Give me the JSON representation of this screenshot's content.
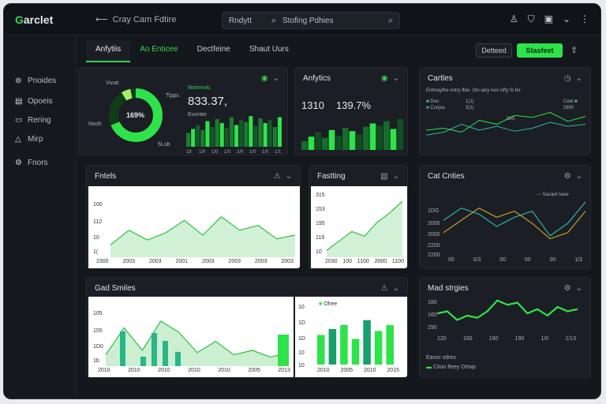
{
  "app": {
    "logo_g": "G",
    "logo_rest": "arclet",
    "back_label": "Cray Cam Fdtire"
  },
  "search": {
    "label": "Rndytt",
    "placeholder": "Stofing Pdhies"
  },
  "topbar_icons": [
    "user-icon",
    "filter-icon",
    "calendar-icon",
    "chevron-down-icon",
    "more-icon"
  ],
  "sidebar": {
    "items": [
      {
        "icon": "⊚",
        "label": "Pnoides"
      },
      {
        "icon": "▤",
        "label": "Opoeis"
      },
      {
        "icon": "▭",
        "label": "Rering"
      },
      {
        "icon": "△",
        "label": "Mirp"
      },
      {
        "icon": "⚙",
        "label": "Fnors"
      }
    ]
  },
  "tabs": [
    "Anfytiis",
    "Ao Enticee",
    "Dectfeine",
    "Shaut Uurs"
  ],
  "toolbar": {
    "outline_label": "Detteed",
    "green_label": "Stasfeet",
    "share_icon": "share-icon"
  },
  "cards": {
    "donut": {
      "center": "169%",
      "labels": [
        "Vurat",
        "Tipps",
        "Nooh",
        "5Lub"
      ],
      "metric": "833.37,",
      "legend_top": "Noinmvic",
      "legend_bottom": "Euvnter",
      "x_ticks": [
        "18",
        "1/0",
        "1/0",
        "1/0",
        "2/0",
        "1/0",
        "1/0",
        "1/1"
      ]
    },
    "analytics": {
      "title": "Anfytics",
      "v1": "1310",
      "v2": "139.7%"
    },
    "cartles": {
      "title": "Cartles",
      "caption": "Entmaythe entry fbie. Oin ainy neo cifty fo fer",
      "legend_a": "Doo",
      "legend_b": "Conjse",
      "legend_c": "Ceel",
      "legend_d": "2800",
      "value_label": "39S",
      "left_ticks": [
        "1(1)",
        "3(1)"
      ]
    },
    "fantels": {
      "title": "Fntels",
      "y_ticks": [
        "100",
        "112",
        "10",
        "1("
      ],
      "x_ticks": [
        "2300",
        "2003",
        "2003",
        "2001",
        "2003",
        "2003",
        "2003",
        "2003"
      ]
    },
    "fastting": {
      "title": "Fastting",
      "y_ticks": [
        "315",
        "153",
        "195",
        "119",
        "10"
      ],
      "x_ticks": [
        "2030",
        "100",
        "1100",
        "2000",
        "1100"
      ]
    },
    "cat_charts": {
      "title": "Cat Cnties",
      "legend": "Sacaet tawe",
      "y_ticks": [
        "1DG",
        "2000",
        "2000",
        "2200",
        "2200"
      ],
      "x_ticks": [
        "00",
        "0/3",
        "00",
        "00",
        "00",
        "1/3"
      ]
    },
    "cad_smiles": {
      "title": "Gad Smiles",
      "y_ticks": [
        "105",
        "155",
        "1D0",
        "1b"
      ],
      "x_ticks": [
        "2010",
        "2010",
        "2010",
        "2010",
        "2010",
        "2005",
        "2013"
      ],
      "y2_ticks": [
        "10",
        "1D",
        "1D",
        "10",
        "10"
      ],
      "legend": "Ohee",
      "x2_ticks": [
        "2010",
        "2005",
        "2010",
        "2015"
      ]
    },
    "mad_strings": {
      "title": "Mad strgies",
      "y_ticks": [
        "180",
        "160",
        "290"
      ],
      "x_ticks": [
        "120",
        "100",
        "190",
        "190",
        "1/0",
        "1/13"
      ],
      "footer_label": "Eaner sdres",
      "footer_legend": "Citoo fteey Ortwp"
    }
  },
  "chart_data": [
    {
      "type": "pie",
      "values": [
        69,
        31
      ],
      "title": ""
    },
    {
      "type": "bar",
      "values": [
        14,
        18,
        22,
        17,
        26,
        20,
        28,
        24,
        19,
        30,
        22,
        27,
        25,
        31,
        21,
        29,
        24,
        27,
        20,
        30
      ]
    },
    {
      "type": "bar",
      "values": [
        8,
        12,
        16,
        11,
        18,
        13,
        20,
        17,
        14,
        21,
        24,
        22,
        26,
        19,
        28
      ]
    },
    {
      "type": "line",
      "series": [
        {
          "values": [
            20,
            22,
            18,
            30,
            26,
            35,
            33,
            38,
            29,
            34
          ]
        },
        {
          "values": [
            15,
            18,
            26,
            20,
            24,
            19,
            22,
            28,
            24,
            26
          ]
        }
      ]
    },
    {
      "type": "area",
      "values": [
        10,
        22,
        14,
        20,
        30,
        18,
        33,
        22,
        26,
        15,
        18
      ]
    },
    {
      "type": "area",
      "values": [
        6,
        14,
        22,
        18,
        30,
        38,
        48
      ]
    },
    {
      "type": "line",
      "series": [
        {
          "values": [
            22,
            30,
            26,
            18,
            24,
            28,
            12,
            20,
            34
          ]
        },
        {
          "values": [
            14,
            22,
            30,
            24,
            28,
            20,
            10,
            14,
            28
          ]
        }
      ]
    },
    {
      "type": "area",
      "values": [
        10,
        34,
        14,
        40,
        30,
        12,
        22,
        10,
        14,
        8,
        12
      ]
    },
    {
      "type": "bar",
      "values": [
        30,
        36,
        40,
        26,
        45,
        34,
        40
      ]
    },
    {
      "type": "line",
      "values": [
        18,
        20,
        12,
        16,
        14,
        20,
        30,
        26,
        28,
        18,
        22,
        16,
        24,
        20,
        22
      ]
    }
  ]
}
